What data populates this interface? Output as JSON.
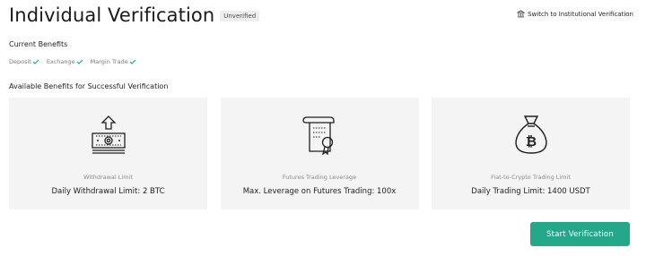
{
  "header": {
    "title": "Individual Verification",
    "status_badge": "Unverified",
    "switch_link_label": "Switch to Institutional Verification"
  },
  "current_benefits": {
    "label": "Current Benefits",
    "items": [
      {
        "label": "Deposit",
        "icon": "check-icon"
      },
      {
        "label": "Exchange",
        "icon": "check-icon"
      },
      {
        "label": "Margin Trade",
        "icon": "check-icon"
      }
    ]
  },
  "available_benefits": {
    "label": "Available Benefits for Successful Verification",
    "cards": [
      {
        "icon": "withdraw-cash-icon",
        "caption": "Withdrawal Limit",
        "value": "Daily Withdrawal Limit: 2 BTC"
      },
      {
        "icon": "certificate-scroll-icon",
        "caption": "Futures Trading Leverage",
        "value": "Max. Leverage on Futures Trading: 100x"
      },
      {
        "icon": "bitcoin-money-bag-icon",
        "caption": "Fiat-to-Crypto Trading Limit",
        "value": "Daily Trading Limit: 1400 USDT"
      }
    ]
  },
  "actions": {
    "start_label": "Start Verification"
  },
  "colors": {
    "accent": "#24a889",
    "check": "#24a889",
    "card_bg": "#f4f4f5"
  }
}
